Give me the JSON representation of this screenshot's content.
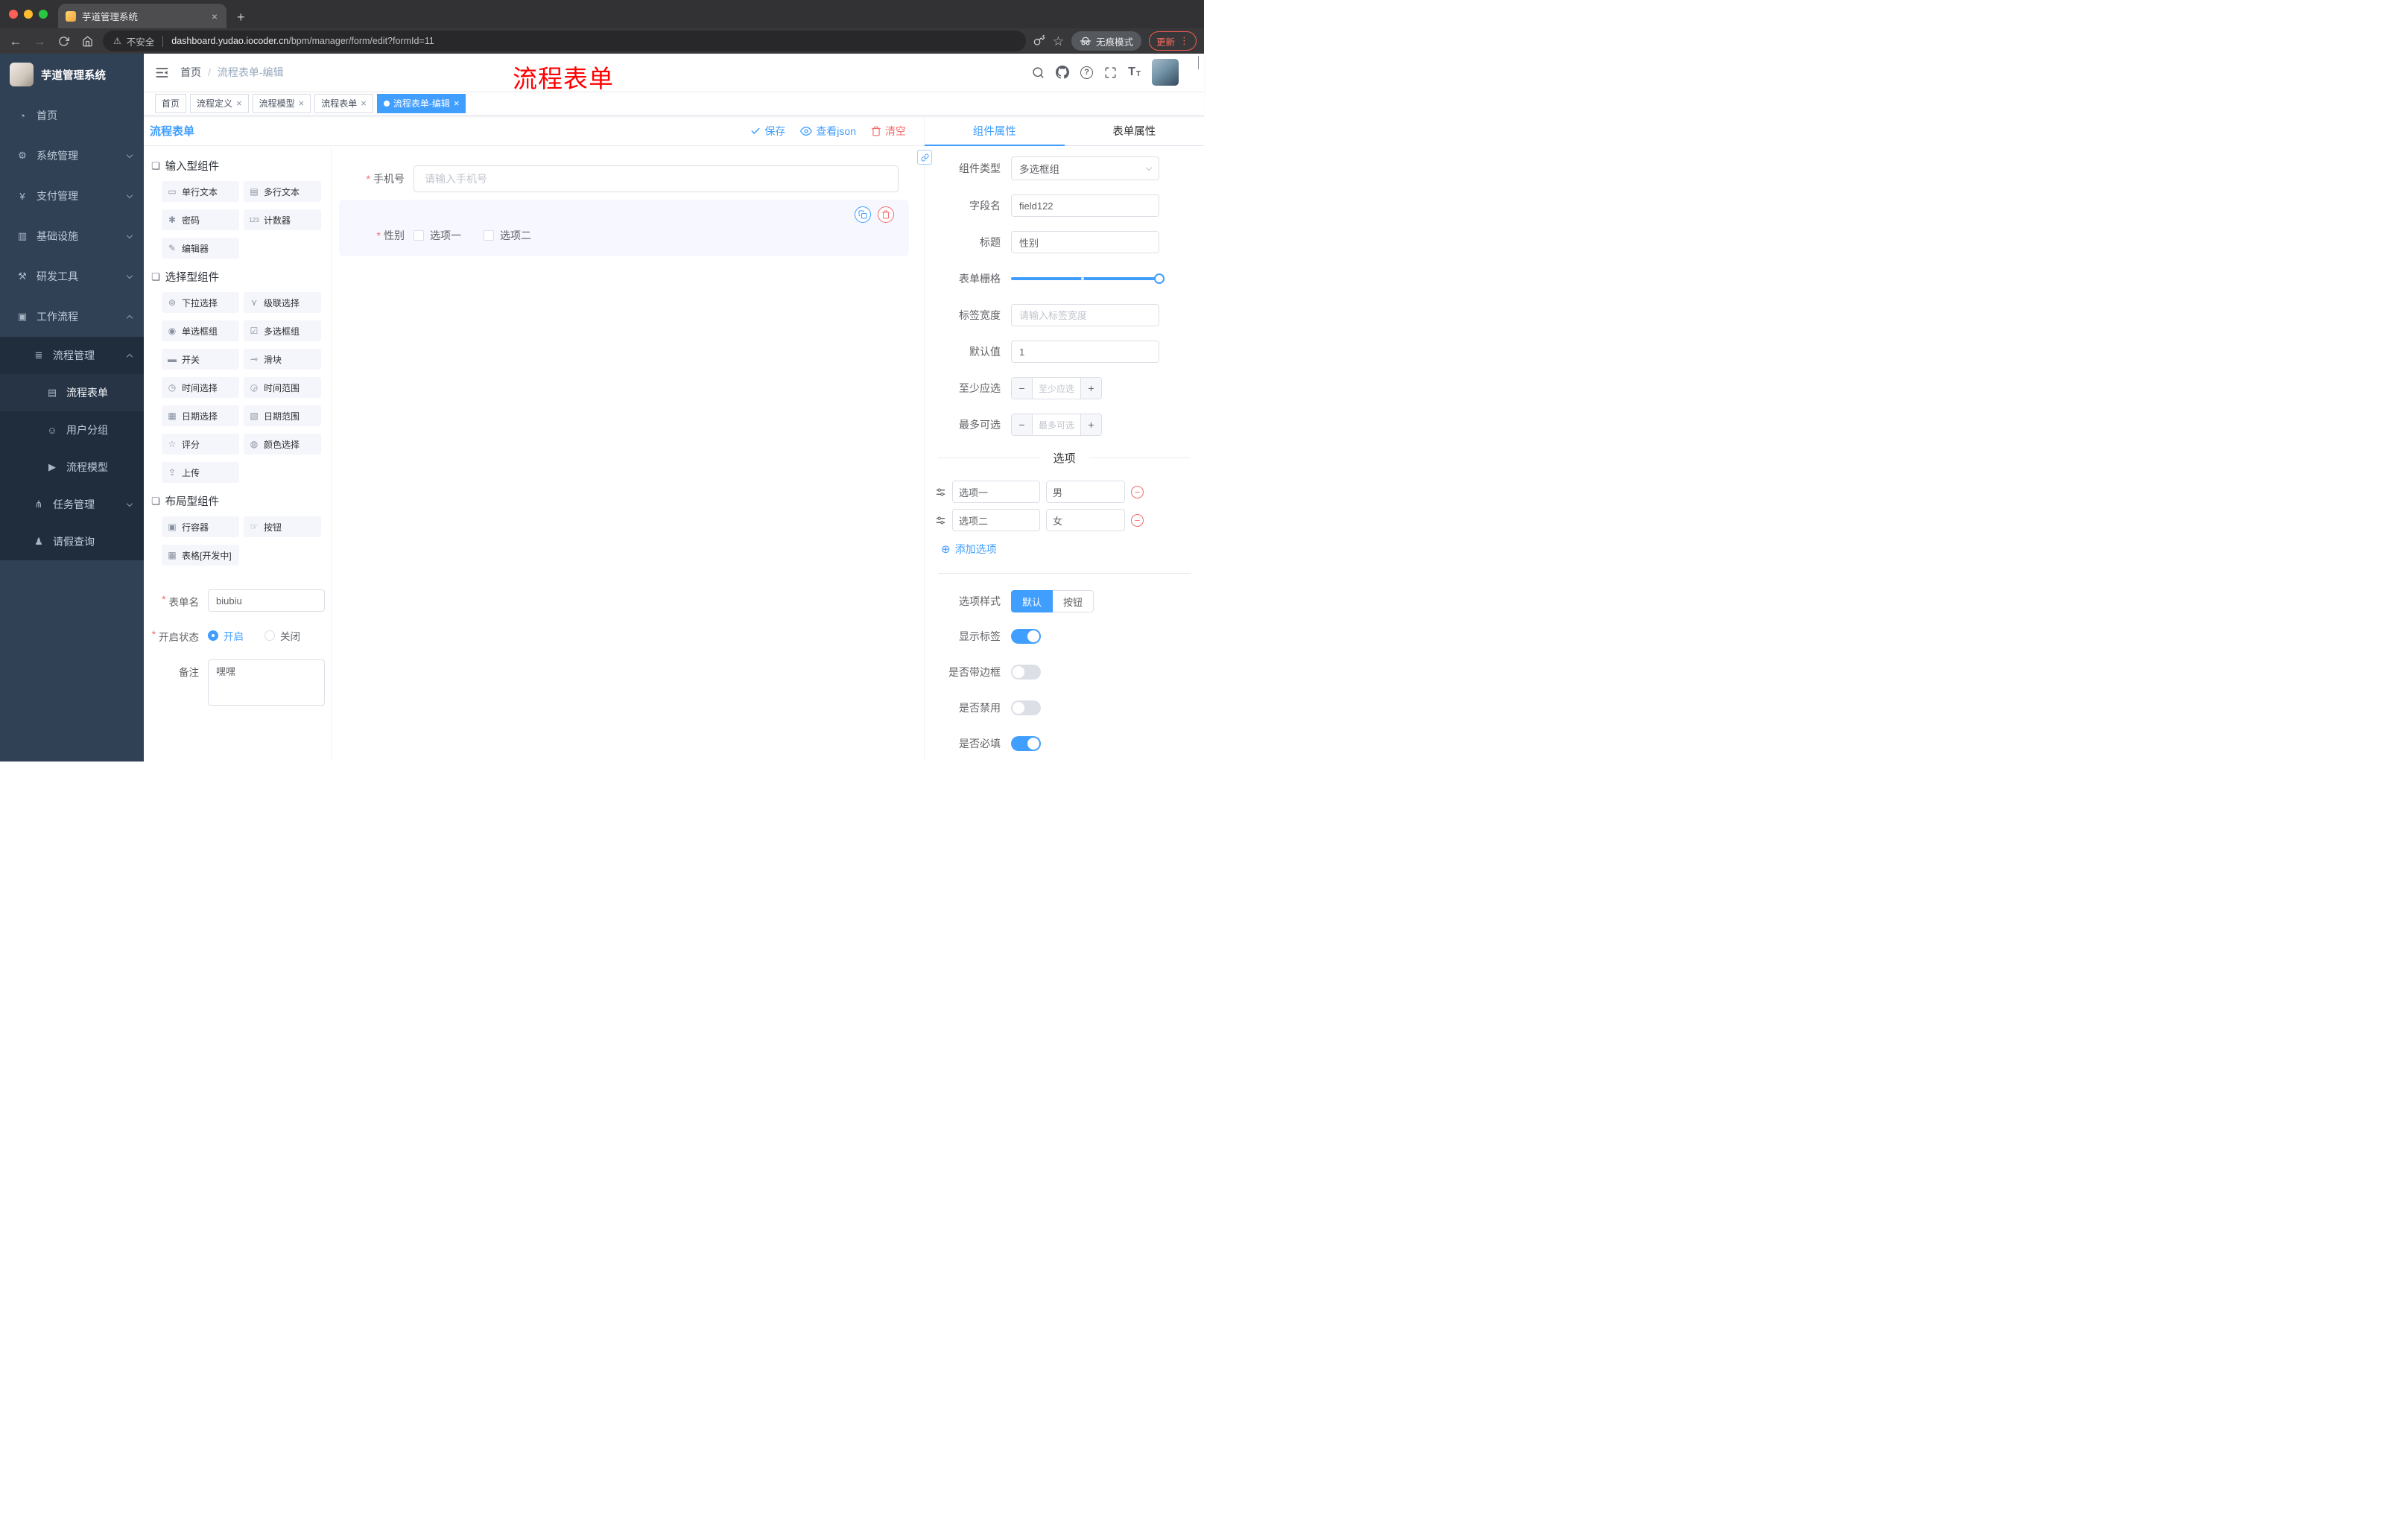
{
  "browser": {
    "tab": {
      "title": "芋道管理系统"
    },
    "address": {
      "security": "不安全",
      "url_domain": "dashboard.yudao.iocoder.cn",
      "url_path": "/bpm/manager/form/edit?formId=11"
    },
    "incognito_label": "无痕模式",
    "update_label": "更新"
  },
  "sidebar": {
    "logo_title": "芋道管理系统",
    "items": [
      {
        "label": "首页"
      },
      {
        "label": "系统管理"
      },
      {
        "label": "支付管理"
      },
      {
        "label": "基础设施"
      },
      {
        "label": "研发工具"
      },
      {
        "label": "工作流程"
      }
    ],
    "submenu": {
      "process_mgmt": "流程管理",
      "process_form": "流程表单",
      "user_group": "用户分组",
      "process_model": "流程模型",
      "task_mgmt": "任务管理",
      "leave_query": "请假查询"
    }
  },
  "navbar": {
    "breadcrumb": {
      "home": "首页",
      "current": "流程表单-编辑"
    },
    "overlay_title": "流程表单"
  },
  "tags": [
    {
      "label": "首页"
    },
    {
      "label": "流程定义"
    },
    {
      "label": "流程模型"
    },
    {
      "label": "流程表单"
    },
    {
      "label": "流程表单-编辑"
    }
  ],
  "designer": {
    "panel_title": "流程表单",
    "toolbar": {
      "save": "保存",
      "json": "查看json",
      "clear": "清空"
    },
    "palette": {
      "sections": [
        {
          "title": "输入型组件"
        },
        {
          "title": "选择型组件"
        },
        {
          "title": "布局型组件"
        }
      ],
      "input_items": [
        "单行文本",
        "多行文本",
        "密码",
        "计数器",
        "编辑器"
      ],
      "select_items": [
        "下拉选择",
        "级联选择",
        "单选框组",
        "多选框组",
        "开关",
        "滑块",
        "时间选择",
        "时间范围",
        "日期选择",
        "日期范围",
        "评分",
        "颜色选择",
        "上传"
      ],
      "layout_items": [
        "行容器",
        "按钮",
        "表格[开发中]"
      ]
    },
    "form_settings": {
      "name_label": "表单名",
      "name_value": "biubiu",
      "status_label": "开启状态",
      "status_on": "开启",
      "status_off": "关闭",
      "remark_label": "备注",
      "remark_value": "嘿嘿"
    },
    "canvas": {
      "phone": {
        "label": "手机号",
        "placeholder": "请输入手机号"
      },
      "gender": {
        "label": "性别",
        "option1": "选项一",
        "option2": "选项二"
      }
    },
    "props": {
      "tab_component": "组件属性",
      "tab_form": "表单属性",
      "type_label": "组件类型",
      "type_value": "多选框组",
      "field_label": "字段名",
      "field_value": "field122",
      "title_label": "标题",
      "title_value": "性别",
      "grid_label": "表单栅格",
      "width_label": "标签宽度",
      "width_placeholder": "请输入标签宽度",
      "default_label": "默认值",
      "default_value": "1",
      "min_label": "至少应选",
      "min_placeholder": "至少应选",
      "max_label": "最多可选",
      "max_placeholder": "最多可选",
      "options_title": "选项",
      "option_rows": [
        {
          "name": "选项一",
          "value": "男"
        },
        {
          "name": "选项二",
          "value": "女"
        }
      ],
      "add_option": "添加选项",
      "style_label": "选项样式",
      "style_default": "默认",
      "style_button": "按钮",
      "toggle_show_label": "显示标签",
      "toggle_border": "是否带边框",
      "toggle_disabled": "是否禁用",
      "toggle_required": "是否必填"
    }
  },
  "colors": {
    "accent": "#409EFF",
    "danger": "#F56C6C",
    "sidebar": "#304156",
    "annotation_red": "#FF0000"
  },
  "glyphs": {
    "close": "×",
    "newTab": "+",
    "back": "←",
    "forward": "→",
    "warning": "⚠",
    "star": "☆",
    "kebab": "⋮",
    "check": "✓",
    "addCircle": "⊕",
    "minusThin": "−",
    "plusThin": "+",
    "sep": "/",
    "question": "?",
    "fontBig": "T",
    "fontSmall": "T",
    "section": "❏",
    "home": "◔",
    "system": "⚙",
    "pay": "¥",
    "infra": "▥",
    "devtools": "⚒",
    "workflow": "▣",
    "processMgmt": "≣",
    "processForm": "▤",
    "userGroup": "☺",
    "processModel": "▶",
    "taskMgmt": "⋔",
    "leaveQuery": "♟",
    "input": "▭",
    "textarea": "▤",
    "password": "✱",
    "counter": "123",
    "editor": "✎",
    "select": "⊚",
    "cascader": "⋎",
    "radio": "◉",
    "checkbox": "☑",
    "switch": "▬",
    "slider": "⊸",
    "time": "◷",
    "timeRange": "◶",
    "date": "▦",
    "dateRange": "▧",
    "rate": "☆",
    "color": "◍",
    "upload": "⇪",
    "row": "▣",
    "button": "☞",
    "table": "▦"
  }
}
